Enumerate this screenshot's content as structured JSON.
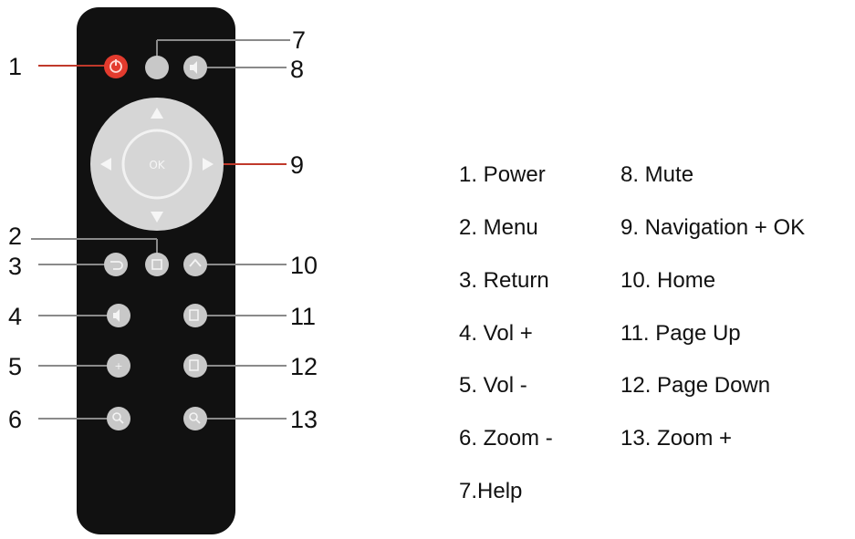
{
  "diagram": {
    "accent_power": "#e33b2e",
    "button_color": "#c8c8c8",
    "dpad_color": "#d6d6d6",
    "remote_color": "#111111",
    "callout_line_red": "#c0392b",
    "callout_line_gray": "#8a8a8a",
    "ok_label": "OK",
    "callouts": [
      "1",
      "2",
      "3",
      "4",
      "5",
      "6",
      "7",
      "8",
      "9",
      "10",
      "11",
      "12",
      "13"
    ],
    "legend": {
      "col1": [
        "1. Power",
        "2. Menu",
        "3. Return",
        "4. Vol +",
        "5. Vol -",
        "6. Zoom -",
        "7.Help"
      ],
      "col2": [
        "8. Mute",
        "9. Navigation + OK",
        "10. Home",
        "11. Page Up",
        "12. Page Down",
        "13. Zoom +"
      ]
    }
  }
}
